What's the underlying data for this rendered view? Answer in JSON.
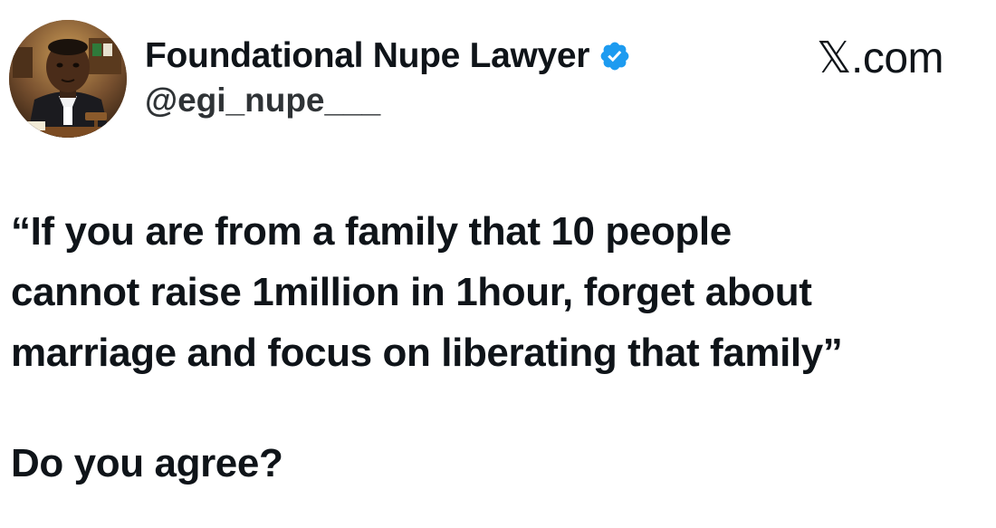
{
  "source": {
    "label": "𝕏.com"
  },
  "author": {
    "display_name": "Foundational Nupe Lawyer",
    "handle": "@egi_nupe___",
    "verified": true,
    "verified_color": "#1d9bf0",
    "avatar_icon": "lawyer-avatar"
  },
  "post": {
    "text": "“If you are from a family that 10 people\ncannot raise 1million in 1hour, forget about\nmarriage and focus on liberating that family”",
    "question": "Do you agree?"
  }
}
